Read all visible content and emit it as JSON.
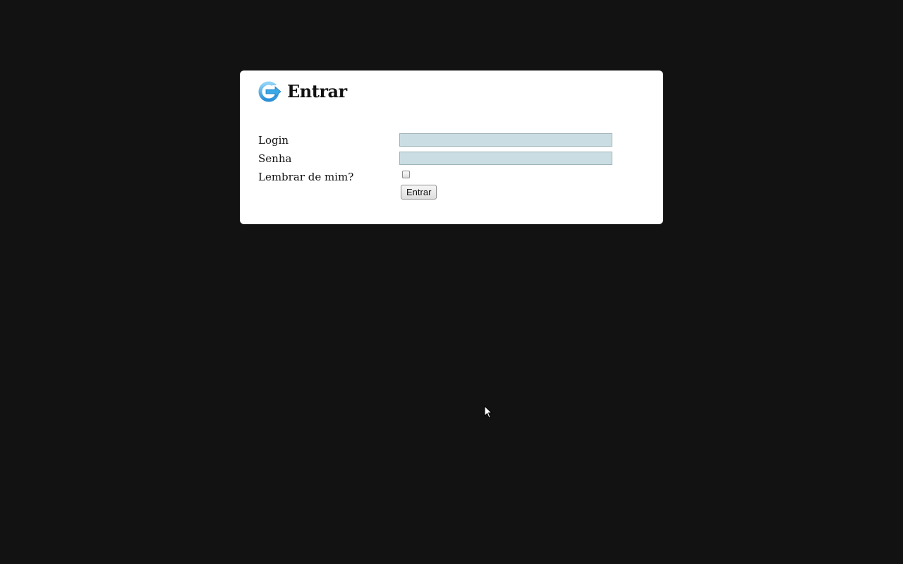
{
  "login": {
    "title": "Entrar",
    "icon": "login-arrow-icon",
    "fields": {
      "login_label": "Login",
      "login_value": "",
      "password_label": "Senha",
      "password_value": "",
      "remember_label": "Lembrar de mim?",
      "remember_checked": false
    },
    "submit_label": "Entrar"
  },
  "colors": {
    "background": "#121212",
    "card": "#ffffff",
    "input_fill": "#c9dde3",
    "icon_blue": "#3aa8e6"
  }
}
